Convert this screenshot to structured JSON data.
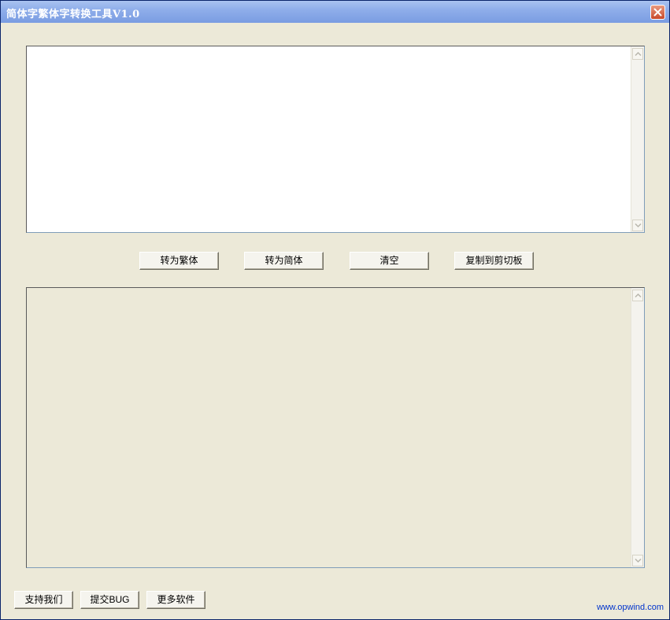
{
  "window": {
    "title": "简体字繁体字转换工具V1.0"
  },
  "input_box": {
    "value": ""
  },
  "output_box": {
    "value": ""
  },
  "actions": {
    "to_traditional": "转为繁体",
    "to_simplified": "转为简体",
    "clear": "清空",
    "copy_clipboard": "复制到剪切板"
  },
  "footer": {
    "support": "支持我们",
    "report_bug": "提交BUG",
    "more_software": "更多软件",
    "website": "www.opwind.com"
  },
  "colors": {
    "titlebar": "#8FAEEA",
    "window_bg": "#ECE9D8",
    "link": "#0033CC",
    "close_button": "#C8482A"
  },
  "icons": [
    "close-icon",
    "scroll-up-arrow-icon",
    "scroll-down-arrow-icon"
  ]
}
